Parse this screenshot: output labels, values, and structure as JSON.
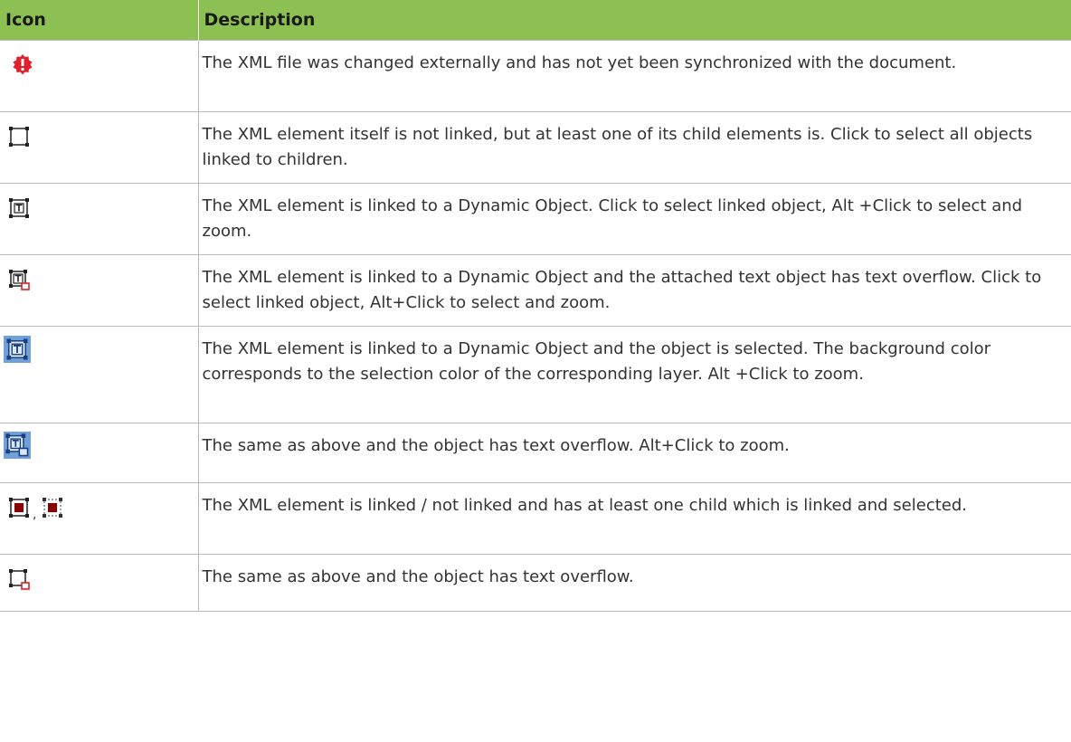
{
  "table": {
    "headers": {
      "icon": "Icon",
      "description": "Description"
    },
    "rows": [
      {
        "icon": "external-change-warning-icon",
        "description": "The XML file was changed externally and has not yet been synchronized with the document."
      },
      {
        "icon": "child-linked-icon",
        "description": "The XML element itself is not linked, but at least one of its child elements is. Click to select all objects linked to children."
      },
      {
        "icon": "dynamic-object-linked-icon",
        "description": "The XML element is linked to a Dynamic Object. Click to select linked object, Alt +Click to select and zoom."
      },
      {
        "icon": "linked-text-overflow-icon",
        "description": "The XML element is linked to a Dynamic Object and the attached text object has text overflow. Click to select linked object, Alt+Click to select and zoom."
      },
      {
        "icon": "linked-selected-icon",
        "description": "The XML element is linked to a Dynamic Object and the object is selected. The background color corresponds to the selection color of the corresponding layer. Alt +Click to zoom."
      },
      {
        "icon": "linked-selected-overflow-icon",
        "description": "The same as above and the object has text overflow. Alt+Click to zoom."
      },
      {
        "icon": "linked-child-selected-icon",
        "icon_separator": ",",
        "icon2": "unlinked-child-selected-icon",
        "description": "The XML element is linked / not linked and has at least one child which is linked and selected."
      },
      {
        "icon": "child-linked-overflow-icon",
        "description": "The same as above and the object has text overflow."
      }
    ]
  },
  "colors": {
    "header_bg": "#8dc053",
    "border": "#b9b9b9",
    "warning_red": "#e0202a",
    "selection_blue": "#6fa0d8",
    "overflow_red": "#e02020",
    "child_selected_fill": "#8b0000"
  }
}
